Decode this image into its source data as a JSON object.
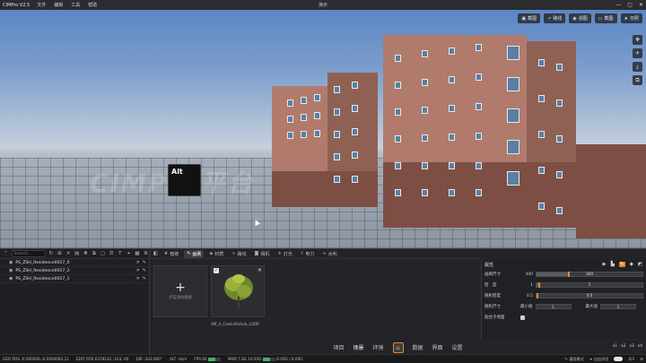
{
  "titlebar": {
    "app_title": "CIMPro V2.5",
    "menus": [
      "文件",
      "编辑",
      "工具",
      "帮助"
    ],
    "window_title": "演示",
    "controls": {
      "minimize": "—",
      "maximize": "▢",
      "close": "✕"
    }
  },
  "viewport": {
    "watermark": "CIMPro平台",
    "key_overlay": "Alt",
    "top_buttons": [
      {
        "icon": "camera-icon",
        "label": "截图"
      },
      {
        "icon": "path-icon",
        "label": "路线"
      },
      {
        "icon": "view-icon",
        "label": "视图"
      },
      {
        "icon": "screen-icon",
        "label": "截图"
      },
      {
        "icon": "star-icon",
        "label": "日照"
      }
    ],
    "side_tools": [
      "move-icon",
      "bird-icon",
      "download-icon",
      "copy-icon"
    ]
  },
  "left_panel": {
    "search_placeholder": "Search...",
    "layers": [
      {
        "name": "PS_ZSH_Residence0017_0"
      },
      {
        "name": "PS_ZSH_Residence0017_2"
      },
      {
        "name": "PS_ZSH_Residence0017_1"
      }
    ]
  },
  "asset_tabs": [
    {
      "label": "植被",
      "active": false
    },
    {
      "label": "画刷",
      "active": true
    },
    {
      "label": "材质",
      "active": false
    },
    {
      "label": "路线",
      "active": false
    },
    {
      "label": "相机",
      "active": false
    },
    {
      "label": "灯光",
      "active": false
    },
    {
      "label": "电力",
      "active": false
    },
    {
      "label": "水利",
      "active": false
    }
  ],
  "assets": {
    "add_label": "点击添加植被",
    "item_name": "SM_A_CassiaFistula_LOD0"
  },
  "properties": {
    "title": "属性",
    "rows": [
      {
        "label": "画刷尺寸",
        "value": "300",
        "slider_value": "300",
        "fill": 0.3
      },
      {
        "label": "密　度",
        "value": "1",
        "slider_value": "1",
        "fill": 0.02
      },
      {
        "label": "随机密度",
        "value": "0.5",
        "slider_value": "0.0",
        "fill": 0.0
      }
    ],
    "random_size": {
      "label": "随机尺寸",
      "min_label": "最小值",
      "min": "1",
      "max_label": "最大值",
      "max": "1"
    },
    "ground_label": "贴合于地面"
  },
  "bottom_nav": {
    "items": [
      "项目",
      "场景",
      "环境",
      "数据",
      "界面",
      "设置"
    ],
    "active": "场景"
  },
  "corner_labels": [
    "x1",
    "x2",
    "x3",
    "x4"
  ],
  "status": {
    "geo_pos": "GEO POS  -0.000926,-0.0004083,12",
    "edit_pos": "EDIT POS  6378142,-103,-40",
    "dir": "DIR  -343.900°",
    "alt": "ALT  -4km",
    "fps_label": "FPS",
    "fps": "60",
    "fps_fill": 0.6,
    "mem_label": "MEM",
    "mem": "7.8G",
    "gpu": "16.93G",
    "gpu_fill": 0.55,
    "vram": "6.49G / 8.00G",
    "modes": [
      "漫游模式",
      "自由浏览",
      "0/3"
    ],
    "colors": {
      "accent": "#e0892a",
      "green": "#3fb36a"
    }
  }
}
